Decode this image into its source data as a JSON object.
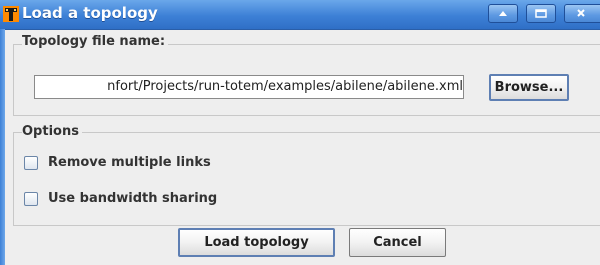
{
  "window": {
    "title": "Load a topology",
    "icon": "totem-app-icon",
    "controls": [
      "minimize-icon",
      "maximize-icon",
      "close-icon"
    ]
  },
  "topology_group": {
    "legend": "Topology file name:",
    "file_path_value": "nfort/Projects/run-totem/examples/abilene/abilene.xml",
    "browse_label": "Browse..."
  },
  "options_group": {
    "legend": "Options",
    "remove_multiple_links": {
      "label": "Remove multiple links",
      "checked": false
    },
    "use_bandwidth_sharing": {
      "label": "Use bandwidth sharing",
      "checked": false
    }
  },
  "actions": {
    "load_label": "Load topology",
    "cancel_label": "Cancel"
  },
  "colors": {
    "titlebar": "#3d80d6",
    "background": "#eeeeee",
    "focus_border": "#5e7fb3"
  }
}
